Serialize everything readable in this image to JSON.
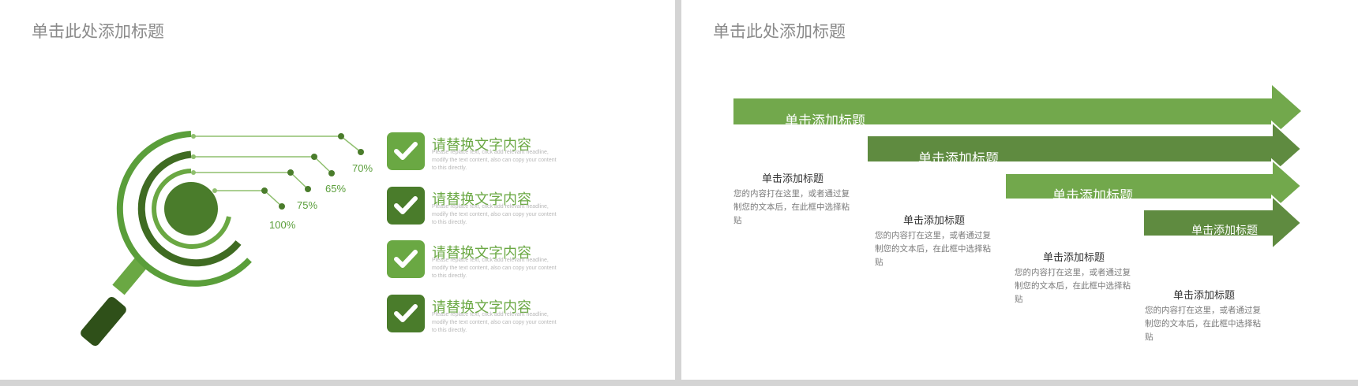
{
  "left_slide": {
    "title": "单击此处添加标题",
    "percentages": [
      "70%",
      "65%",
      "75%",
      "100%"
    ],
    "items": [
      {
        "title": "请替换文字内容",
        "body": "Please replace text, click add relevant headline, modify the text content, also can copy your content to this directly."
      },
      {
        "title": "请替换文字内容",
        "body": "Please replace text, click add relevant headline, modify the text content, also can copy your content to this directly."
      },
      {
        "title": "请替换文字内容",
        "body": "Please replace text, click add relevant headline, modify the text content, also can copy your content to this directly."
      },
      {
        "title": "请替换文字内容",
        "body": "Please replace text, click add relevant headline, modify the text content, also can copy your content to this directly."
      }
    ],
    "colors": {
      "light": "#6aa843",
      "medium": "#5a9e3a",
      "dark": "#4a7c2b",
      "darkest": "#2f5019"
    }
  },
  "right_slide": {
    "title": "单击此处添加标题",
    "arrows": [
      {
        "label": "单击添加标题"
      },
      {
        "label": "单击添加标题"
      },
      {
        "label": "单击添加标题"
      },
      {
        "label": "单击添加标题"
      }
    ],
    "steps": [
      {
        "title": "单击添加标题",
        "body": "您的内容打在这里，或者通过复制您的文本后，在此框中选择粘贴"
      },
      {
        "title": "单击添加标题",
        "body": "您的内容打在这里，或者通过复制您的文本后，在此框中选择粘贴"
      },
      {
        "title": "单击添加标题",
        "body": "您的内容打在这里，或者通过复制您的文本后，在此框中选择粘贴"
      },
      {
        "title": "单击添加标题",
        "body": "您的内容打在这里，或者通过复制您的文本后，在此框中选择粘贴"
      }
    ],
    "colors": {
      "light": "#72a84c",
      "dark": "#5f8b40"
    }
  }
}
